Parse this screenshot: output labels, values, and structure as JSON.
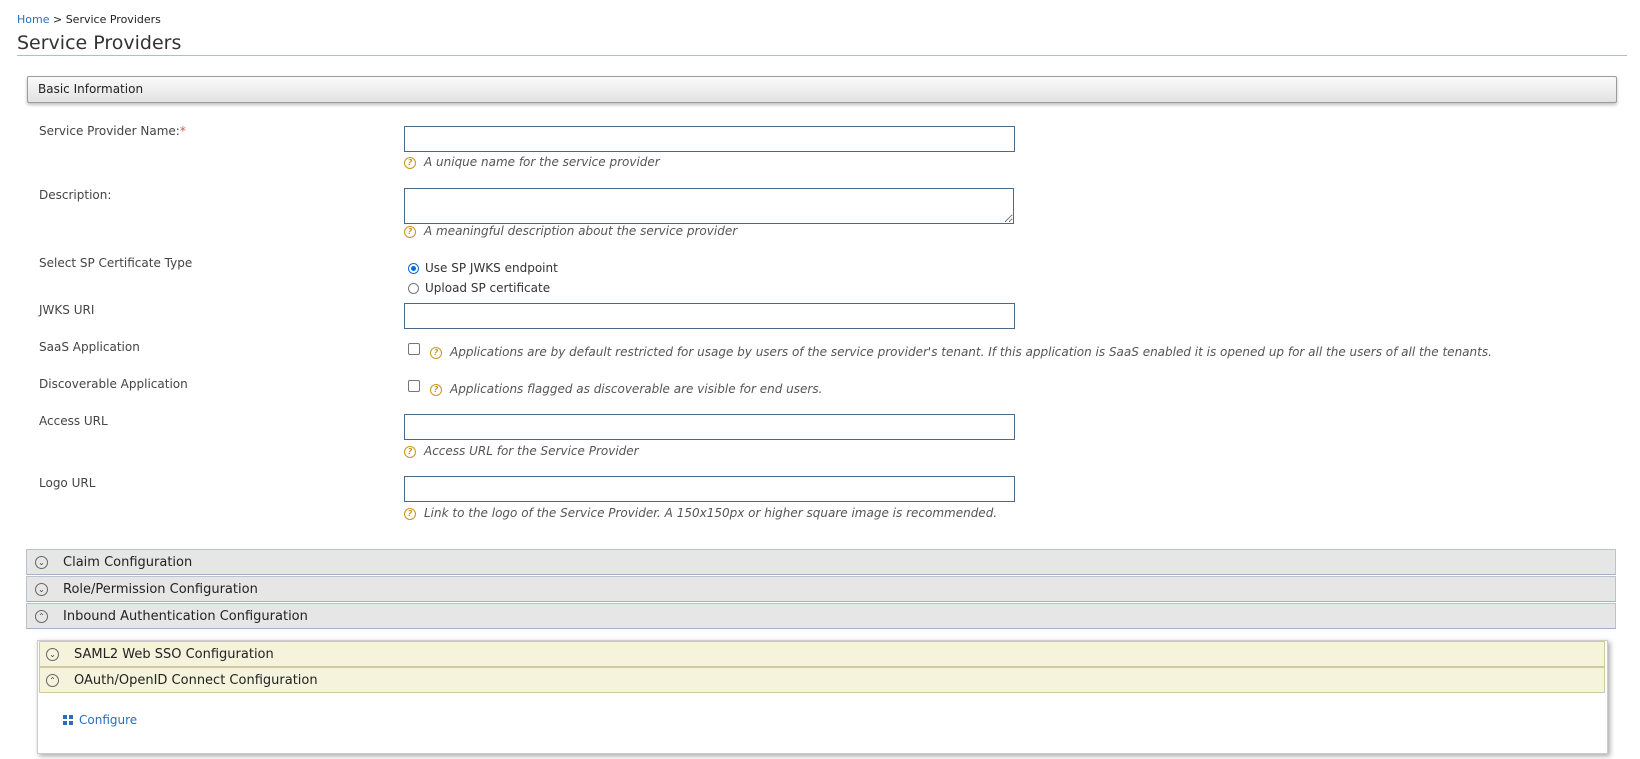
{
  "breadcrumb": {
    "home": "Home",
    "separator": ">",
    "current": "Service Providers"
  },
  "page_title": "Service Providers",
  "basic_info": {
    "title": "Basic Information"
  },
  "fields": {
    "sp_name": {
      "label": "Service Provider Name:",
      "required": "*",
      "value": "",
      "hint": "A unique name for the service provider"
    },
    "description": {
      "label": "Description:",
      "value": "",
      "hint": "A meaningful description about the service provider"
    },
    "cert_type": {
      "label": "Select SP Certificate Type",
      "options": [
        "Use SP JWKS endpoint",
        "Upload SP certificate"
      ],
      "selected": "Use SP JWKS endpoint"
    },
    "jwks_uri": {
      "label": "JWKS URI",
      "value": ""
    },
    "saas": {
      "label": "SaaS Application",
      "checked": false,
      "hint": "Applications are by default restricted for usage by users of the service provider's tenant. If this application is SaaS enabled it is opened up for all the users of all the tenants."
    },
    "discoverable": {
      "label": "Discoverable Application",
      "checked": false,
      "hint": "Applications flagged as discoverable are visible for end users."
    },
    "access_url": {
      "label": "Access URL",
      "value": "",
      "hint": "Access URL for the Service Provider"
    },
    "logo_url": {
      "label": "Logo URL",
      "value": "",
      "hint": "Link to the logo of the Service Provider. A 150x150px or higher square image is recommended."
    }
  },
  "accordions": {
    "claim": "Claim Configuration",
    "role": "Role/Permission Configuration",
    "inbound": "Inbound Authentication Configuration"
  },
  "inbound_sub": {
    "saml": "SAML2 Web SSO Configuration",
    "oauth": "OAuth/OpenID Connect Configuration",
    "configure": "Configure"
  },
  "icons": {
    "help": "question-circle-icon",
    "collapsed": "chevron-down-circle-icon",
    "expanded": "chevron-up-circle-icon",
    "configure": "grid-icon"
  },
  "colors": {
    "link": "#2a6ebb",
    "required": "#d9534f",
    "help": "#c8961b",
    "radio_selected": "#0b6bd6"
  }
}
